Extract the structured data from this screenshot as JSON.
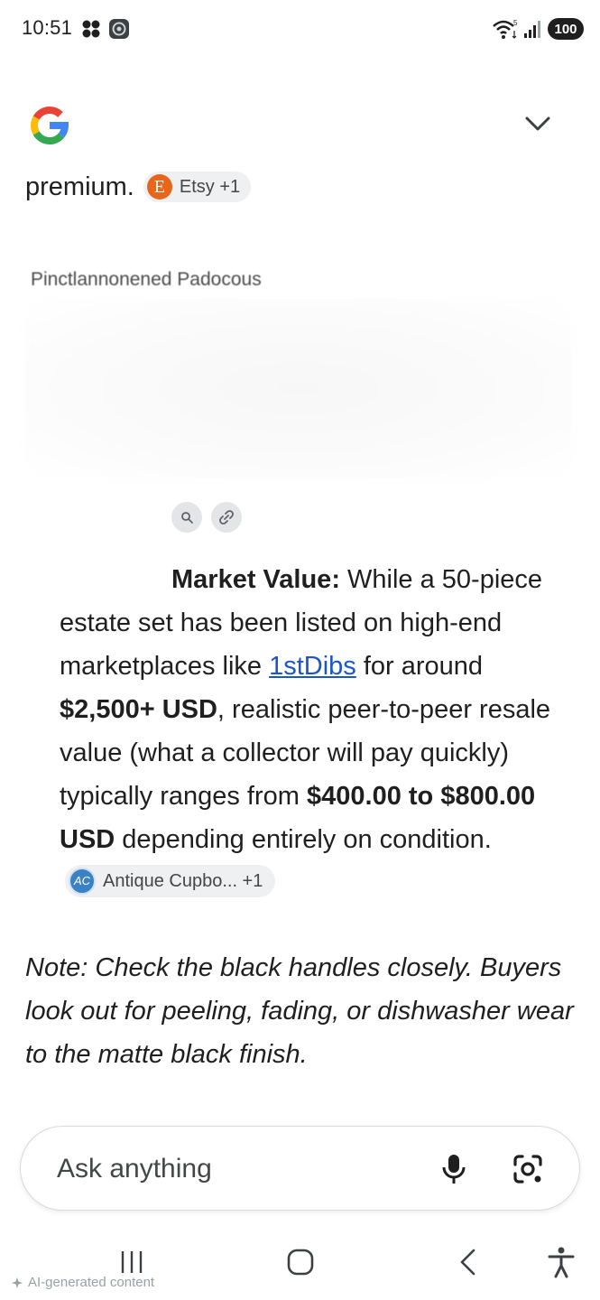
{
  "status_bar": {
    "time": "10:51",
    "battery": "100",
    "icons": [
      "apps-icon",
      "app-badge-icon",
      "wifi-icon",
      "signal-icon",
      "battery-icon"
    ]
  },
  "header": {
    "logo": "google-logo",
    "collapse_icon": "chevron-down-icon"
  },
  "answer": {
    "premium_text": "premium.",
    "etsy_chip": {
      "logo_letter": "E",
      "label": "Etsy +1"
    },
    "blurred_title": "Pinctlannonened Padocous",
    "market": {
      "label": "Market Value:",
      "text1": " While a 50-piece estate set has been listed on high-end marketplaces like ",
      "link": "1stDibs",
      "text2": " for around ",
      "price1": "$2,500+ USD",
      "text3": ", realistic peer-to-peer resale value (what a collector will pay quickly) typically ranges from ",
      "price_range": "$400.00 to $800.00 USD",
      "text4": " depending entirely on condition.",
      "source_chip": {
        "logo_text": "AC",
        "label": "Antique Cupbo... +1"
      }
    },
    "note": "Note: Check the black handles closely. Buyers look out for peeling, fading, or dishwasher wear to the matte black finish."
  },
  "ask_bar": {
    "placeholder": "Ask anything",
    "mic_icon": "mic-icon",
    "lens_icon": "lens-icon"
  },
  "footer": {
    "ai_label": "AI-generated content"
  },
  "colors": {
    "link": "#1a56c8",
    "etsy": "#e8661c",
    "chip_bg": "#eef0f2"
  }
}
